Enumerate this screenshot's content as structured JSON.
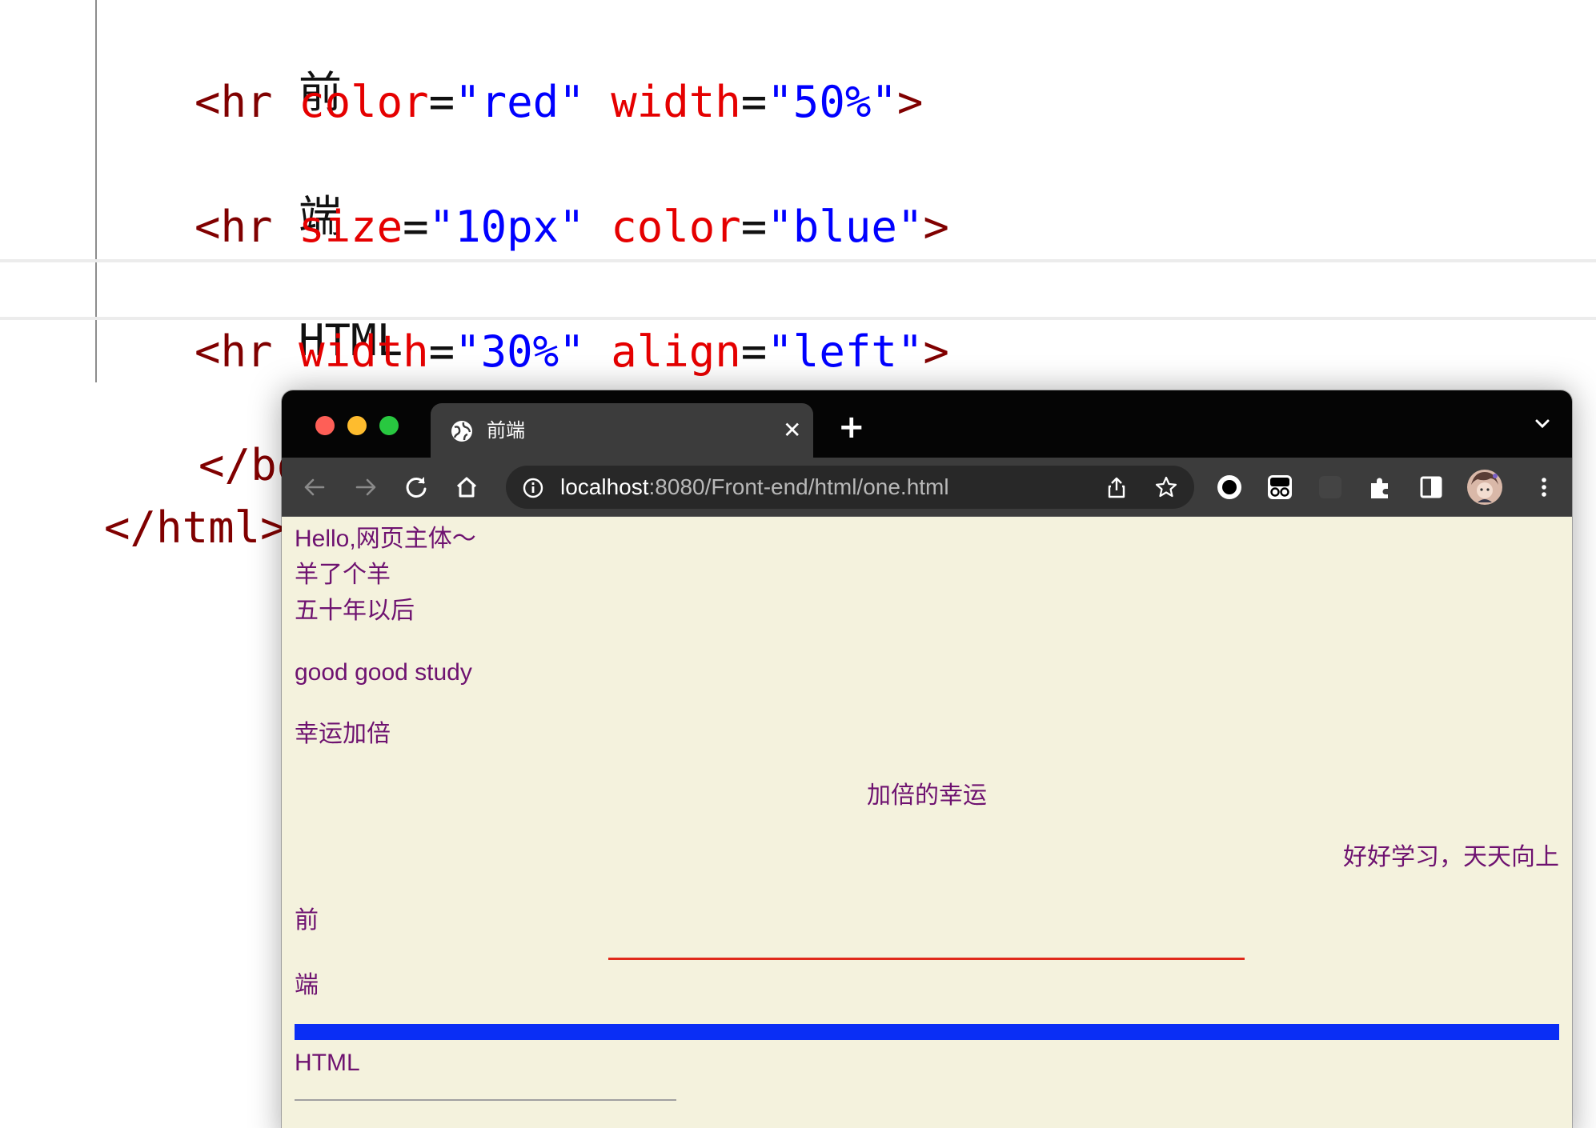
{
  "editor": {
    "lines": [
      {
        "text": "前"
      },
      {
        "tag_open": "<hr",
        "attr1": "color",
        "eq1": "=",
        "val1": "\"red\"",
        "attr2": "width",
        "eq2": "=",
        "val2": "\"50%\"",
        "tag_close": ">"
      },
      {
        "text": "端"
      },
      {
        "tag_open": "<hr",
        "attr1": "size",
        "eq1": "=",
        "val1": "\"10px\"",
        "attr2": "color",
        "eq2": "=",
        "val2": "\"blue\"",
        "tag_close": ">"
      },
      {
        "text": "HTML"
      },
      {
        "tag_open": "<hr",
        "attr1": "width",
        "eq1": "=",
        "val1": "\"30%\"",
        "attr2": "align",
        "eq2": "=",
        "val2": "\"left\"",
        "tag_close": ">"
      },
      {
        "text": "</body>"
      },
      {
        "text": "</html>"
      }
    ]
  },
  "browser": {
    "tab": {
      "title": "前端",
      "close": "✕",
      "new_tab": "+"
    },
    "omnibox": {
      "host": "localhost",
      "path": ":8080/Front-end/html/one.html"
    },
    "icons": [
      "back-icon",
      "forward-icon",
      "reload-icon",
      "home-icon",
      "site-info-icon",
      "share-icon",
      "bookmark-star-icon",
      "extension-record-icon",
      "extension-glasses-icon",
      "extensions-puzzle-icon",
      "side-panel-icon",
      "profile-avatar",
      "more-menu-icon"
    ]
  },
  "page": {
    "line1": "Hello,网页主体～",
    "line2": "羊了个羊",
    "line3": "五十年以后",
    "line4": "good good study",
    "line5": "幸运加倍",
    "center_text": "加倍的幸运",
    "right_text": "好好学习，天天向上",
    "hr_label1": "前",
    "hr_label2": "端",
    "hr_label3": "HTML"
  },
  "colors": {
    "tag": "#800000",
    "attribute": "#e50000",
    "value": "#0000ff",
    "page_bg": "#f4f2dd",
    "page_text": "#6e1270",
    "hr_red": "#e02a1b",
    "hr_blue": "#0a2ef5"
  }
}
